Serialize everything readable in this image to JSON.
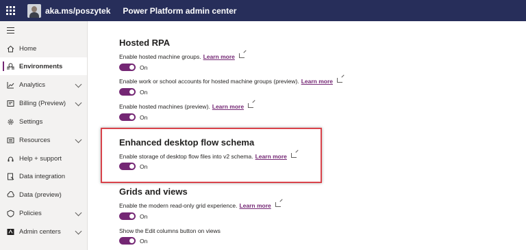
{
  "header": {
    "waffle_icon": "app-launcher-icon",
    "brand": "aka.ms/poszytek",
    "app_title": "Power Platform admin center",
    "bg_color": "#272e5a"
  },
  "sidebar": {
    "items": [
      {
        "label": "Home",
        "icon": "home-icon",
        "expandable": false
      },
      {
        "label": "Environments",
        "icon": "environments-icon",
        "expandable": false,
        "active": true
      },
      {
        "label": "Analytics",
        "icon": "analytics-icon",
        "expandable": true
      },
      {
        "label": "Billing (Preview)",
        "icon": "billing-icon",
        "expandable": true
      },
      {
        "label": "Settings",
        "icon": "gear-icon",
        "expandable": false
      },
      {
        "label": "Resources",
        "icon": "resources-icon",
        "expandable": true
      },
      {
        "label": "Help + support",
        "icon": "help-icon",
        "expandable": false
      },
      {
        "label": "Data integration",
        "icon": "data-integration-icon",
        "expandable": false
      },
      {
        "label": "Data (preview)",
        "icon": "data-preview-icon",
        "expandable": false
      },
      {
        "label": "Policies",
        "icon": "policies-icon",
        "expandable": true
      },
      {
        "label": "Admin centers",
        "icon": "admin-centers-icon",
        "expandable": true
      }
    ],
    "accent_color": "#742774"
  },
  "main": {
    "hosted_rpa": {
      "title": "Hosted RPA",
      "settings": [
        {
          "label": "Enable hosted machine groups.",
          "link": "Learn more",
          "state": "On"
        },
        {
          "label": "Enable work or school accounts for hosted machine groups (preview).",
          "link": "Learn more",
          "state": "On"
        },
        {
          "label": "Enable hosted machines (preview).",
          "link": "Learn more",
          "state": "On"
        }
      ]
    },
    "enhanced_schema": {
      "title": "Enhanced desktop flow schema",
      "settings": [
        {
          "label": "Enable storage of desktop flow files into v2 schema.",
          "link": "Learn more",
          "state": "On"
        }
      ],
      "highlight_color": "#d9424a"
    },
    "grids": {
      "title": "Grids and views",
      "settings": [
        {
          "label": "Enable the modern read-only grid experience.",
          "link": "Learn more",
          "state": "On"
        },
        {
          "label": "Show the Edit columns button on views",
          "link": "",
          "state": "On"
        }
      ]
    },
    "toggle_color": "#742774"
  }
}
